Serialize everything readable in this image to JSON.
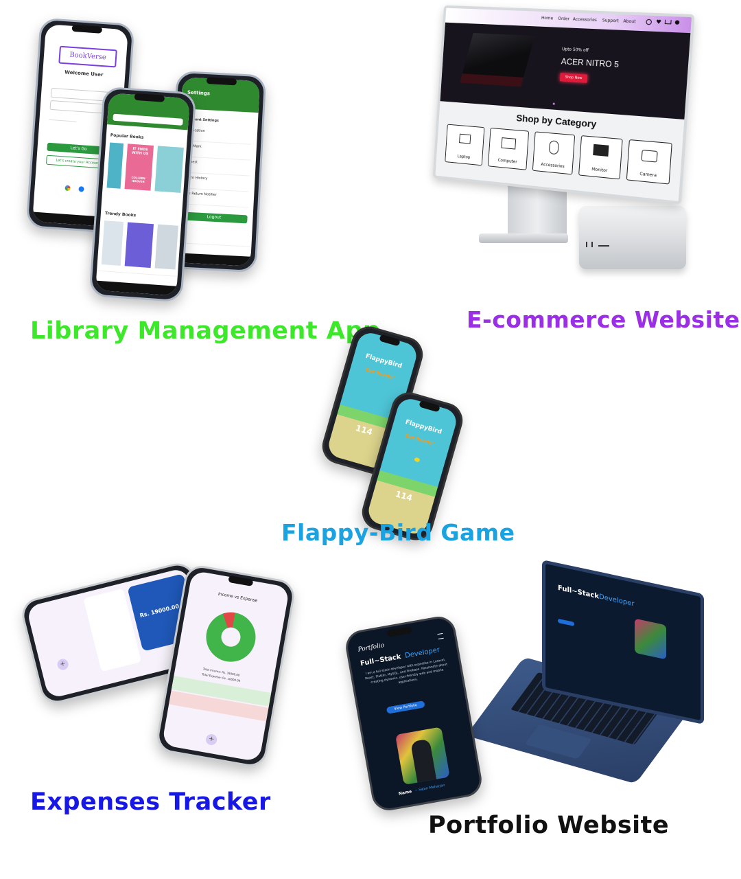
{
  "captions": {
    "library": "Library Management App",
    "ecommerce": "E-commerce Website",
    "flappy": "Flappy-Bird Game",
    "expenses": "Expenses Tracker",
    "portfolio": "Portfolio Website"
  },
  "colors": {
    "library": "#3de82a",
    "ecommerce": "#9b2fe6",
    "flappy": "#1aa3e0",
    "expenses": "#1717e6",
    "portfolio": "#111111"
  },
  "library_app": {
    "brand": "BookVerse",
    "welcome": "Welcome User",
    "login_button": "Let's Go",
    "create_account": "Let's create your Account",
    "popular_books": "Popular Books",
    "trendy_books": "Trendy Books",
    "book_title": "IT ENDS WITH US",
    "book_author": "COLLEEN HOOVER",
    "settings_title": "Settings",
    "account_settings": "Account Settings",
    "settings_items": [
      "Notification",
      "BookMark",
      "Request",
      "Return History",
      "Book Return Notifier"
    ],
    "logout": "Logout"
  },
  "ecommerce_site": {
    "nav_items": [
      "Home",
      "Order",
      "Accessories",
      "Support",
      "About"
    ],
    "promo_small": "Upto 50% off",
    "promo_title": "ACER NITRO 5",
    "promo_button": "Shop Now",
    "section_title": "Shop by Category",
    "categories": [
      "Laptop",
      "Computer",
      "Accessories",
      "Monitor",
      "Camera"
    ]
  },
  "flappy_game": {
    "title": "FlappyBird",
    "subtitle": "Get Ready!",
    "score": "114"
  },
  "expenses_app": {
    "balance": "Rs. 19000.00",
    "chart_title": "Income vs Expense",
    "total_income": "Total Income: Rs. 35000.00",
    "total_expense": "Total Expense: Rs. 16000.00"
  },
  "portfolio_site": {
    "logo": "Portfolio",
    "headline_a": "Full~Stack",
    "headline_b": "Developer",
    "intro": "I am a full stack developer with expertise in Laravel, React, Flutter, MySQL, and Firebase. Passionate about creating dynamic, user-friendly web and mobile applications.",
    "button": "View Portfolio",
    "name_label": "Name",
    "name_value": "~ Sajan Maharjan"
  }
}
